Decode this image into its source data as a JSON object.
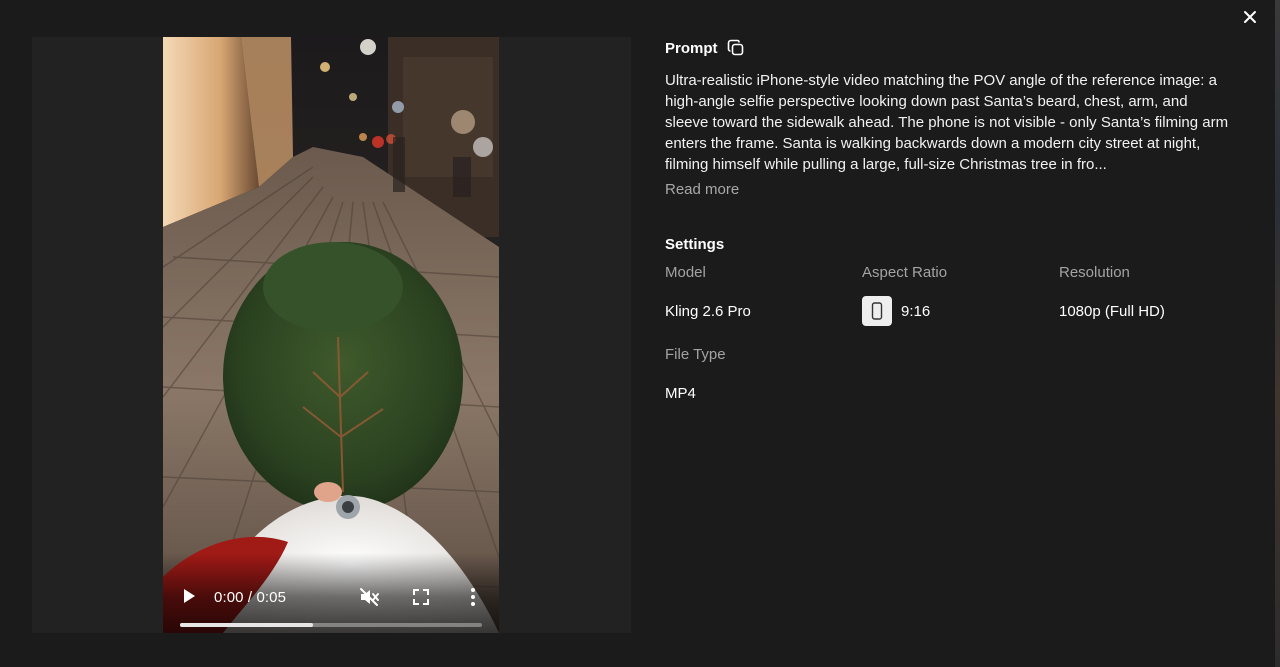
{
  "video": {
    "current_time": "0:00",
    "duration": "0:05",
    "progress": 0.44
  },
  "prompt": {
    "title": "Prompt",
    "text": "Ultra-realistic iPhone-style video matching the POV angle of the reference image: a high-angle selfie perspective looking down past Santa’s beard, chest, arm, and sleeve toward the sidewalk ahead. The phone is not visible - only Santa’s filming arm enters the frame. Santa is walking backwards down a modern city street at night, filming himself while pulling a large, full-size Christmas tree in fro...",
    "read_more": "Read more"
  },
  "settings": {
    "title": "Settings",
    "model_label": "Model",
    "model_value": "Kling 2.6 Pro",
    "aspect_label": "Aspect Ratio",
    "aspect_value": "9:16",
    "resolution_label": "Resolution",
    "resolution_value": "1080p (Full HD)",
    "filetype_label": "File Type",
    "filetype_value": "MP4"
  },
  "icons": {
    "close": "close-icon",
    "copy": "copy-icon",
    "play": "play-icon",
    "mute": "volume-muted-icon",
    "fullscreen": "fullscreen-icon",
    "more": "more-vertical-icon",
    "aspect": "portrait-phone-icon"
  }
}
